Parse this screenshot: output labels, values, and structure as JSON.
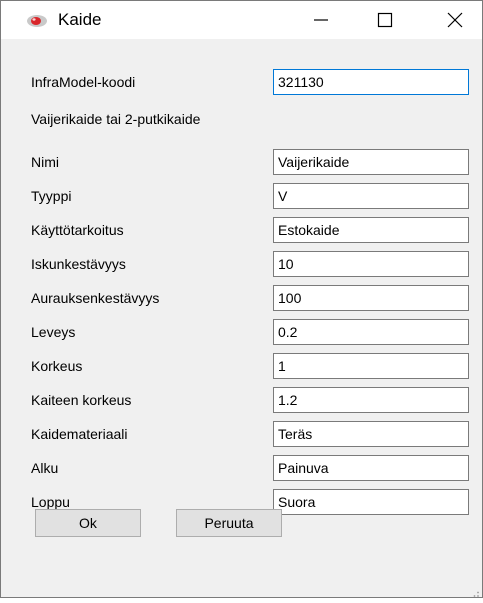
{
  "window": {
    "title": "Kaide",
    "controls": {
      "minimize_icon": "minimize-icon",
      "maximize_icon": "maximize-icon",
      "close_icon": "close-icon"
    }
  },
  "form": {
    "inframodel_label": "InfraModel-koodi",
    "inframodel_value": "321130",
    "category_text": "Vaijerikaide tai 2-putkikaide",
    "fields": [
      {
        "label": "Nimi",
        "value": "Vaijerikaide"
      },
      {
        "label": "Tyyppi",
        "value": "V"
      },
      {
        "label": "Käyttötarkoitus",
        "value": "Estokaide"
      },
      {
        "label": "Iskunkestävyys",
        "value": "10"
      },
      {
        "label": "Aurauksenkestävyys",
        "value": "100"
      },
      {
        "label": "Leveys",
        "value": "0.2"
      },
      {
        "label": "Korkeus",
        "value": "1"
      },
      {
        "label": "Kaiteen korkeus",
        "value": "1.2"
      },
      {
        "label": "Kaidemateriaali",
        "value": "Teräs"
      },
      {
        "label": "Alku",
        "value": "Painuva"
      },
      {
        "label": "Loppu",
        "value": "Suora"
      }
    ]
  },
  "buttons": {
    "ok_label": "Ok",
    "cancel_label": "Peruuta"
  },
  "colors": {
    "focus_border": "#0078d7",
    "window_bg": "#f0f0f0",
    "icon_red": "#d9262b"
  }
}
